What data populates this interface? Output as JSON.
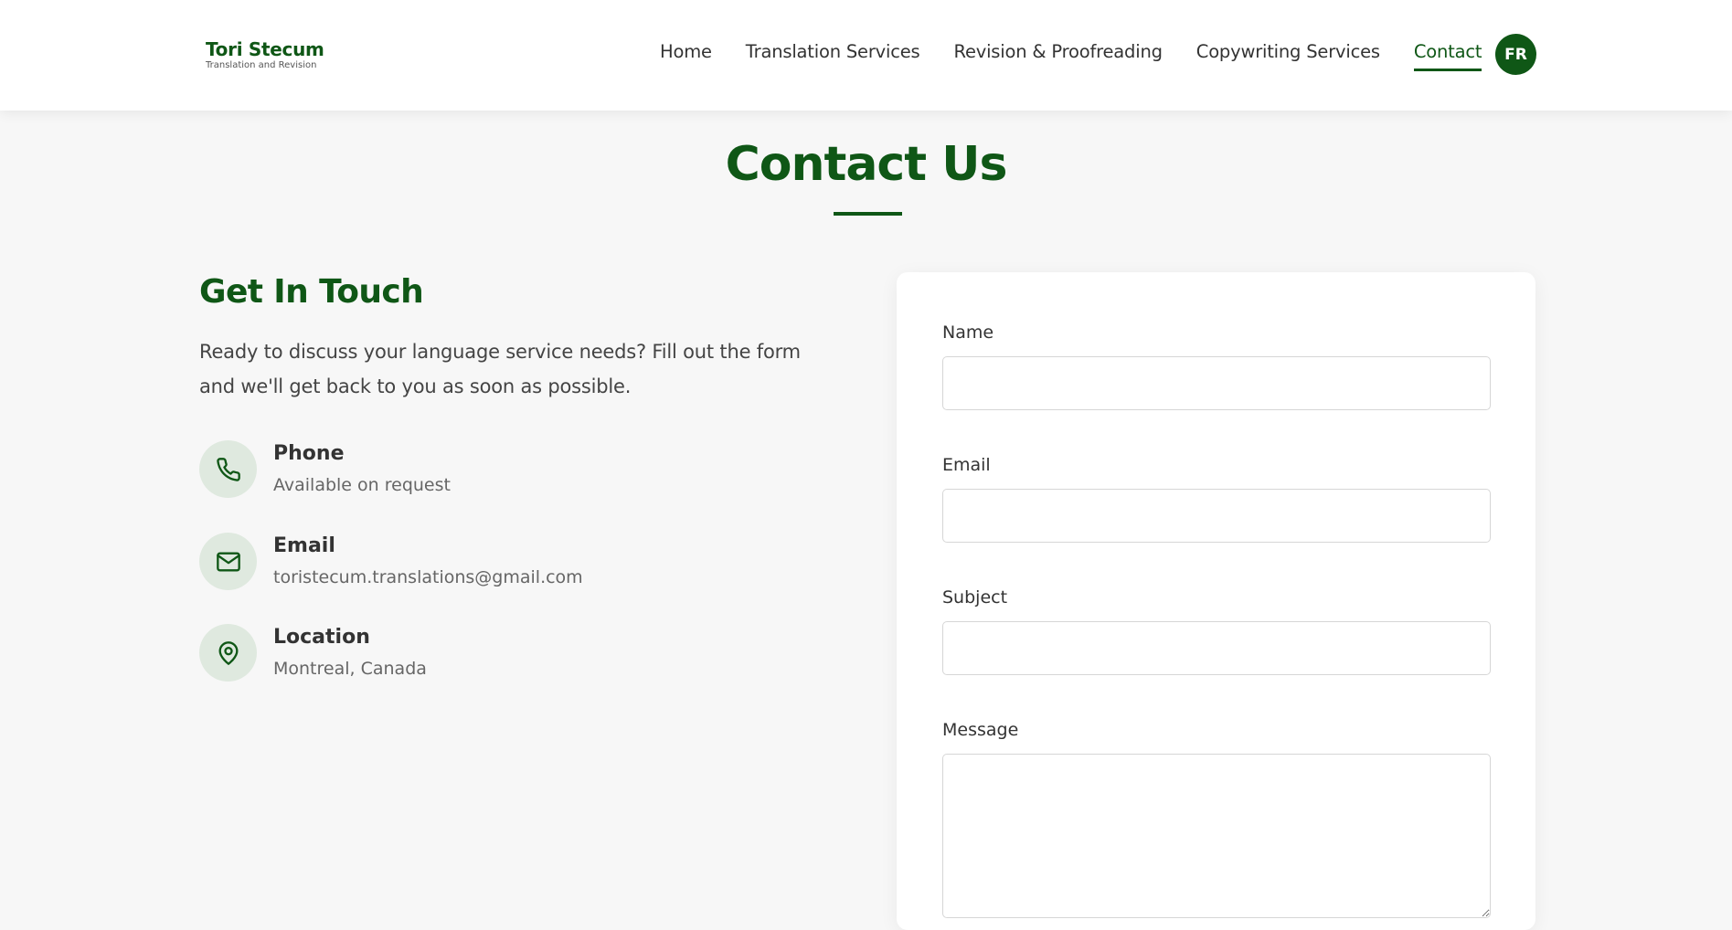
{
  "header": {
    "logo_title": "Tori Stecum",
    "logo_subtitle": "Translation and Revision",
    "nav": [
      {
        "label": "Home",
        "active": false
      },
      {
        "label": "Translation Services",
        "active": false
      },
      {
        "label": "Revision & Proofreading",
        "active": false
      },
      {
        "label": "Copywriting Services",
        "active": false
      },
      {
        "label": "Contact",
        "active": true
      }
    ],
    "language_button": "FR"
  },
  "page": {
    "title": "Contact Us"
  },
  "get_in_touch": {
    "heading": "Get In Touch",
    "intro": "Ready to discuss your language service needs? Fill out the form and we'll get back to you as soon as possible.",
    "items": [
      {
        "icon": "phone-icon",
        "label": "Phone",
        "value": "Available on request"
      },
      {
        "icon": "mail-icon",
        "label": "Email",
        "value": "toristecum.translations@gmail.com"
      },
      {
        "icon": "location-pin-icon",
        "label": "Location",
        "value": "Montreal, Canada"
      }
    ]
  },
  "form": {
    "name_label": "Name",
    "name_value": "",
    "email_label": "Email",
    "email_value": "",
    "subject_label": "Subject",
    "subject_value": "",
    "message_label": "Message",
    "message_value": ""
  },
  "colors": {
    "brand_green": "#0f5716",
    "icon_circle_bg": "#dfe9df",
    "page_bg": "#f7f7f7"
  }
}
